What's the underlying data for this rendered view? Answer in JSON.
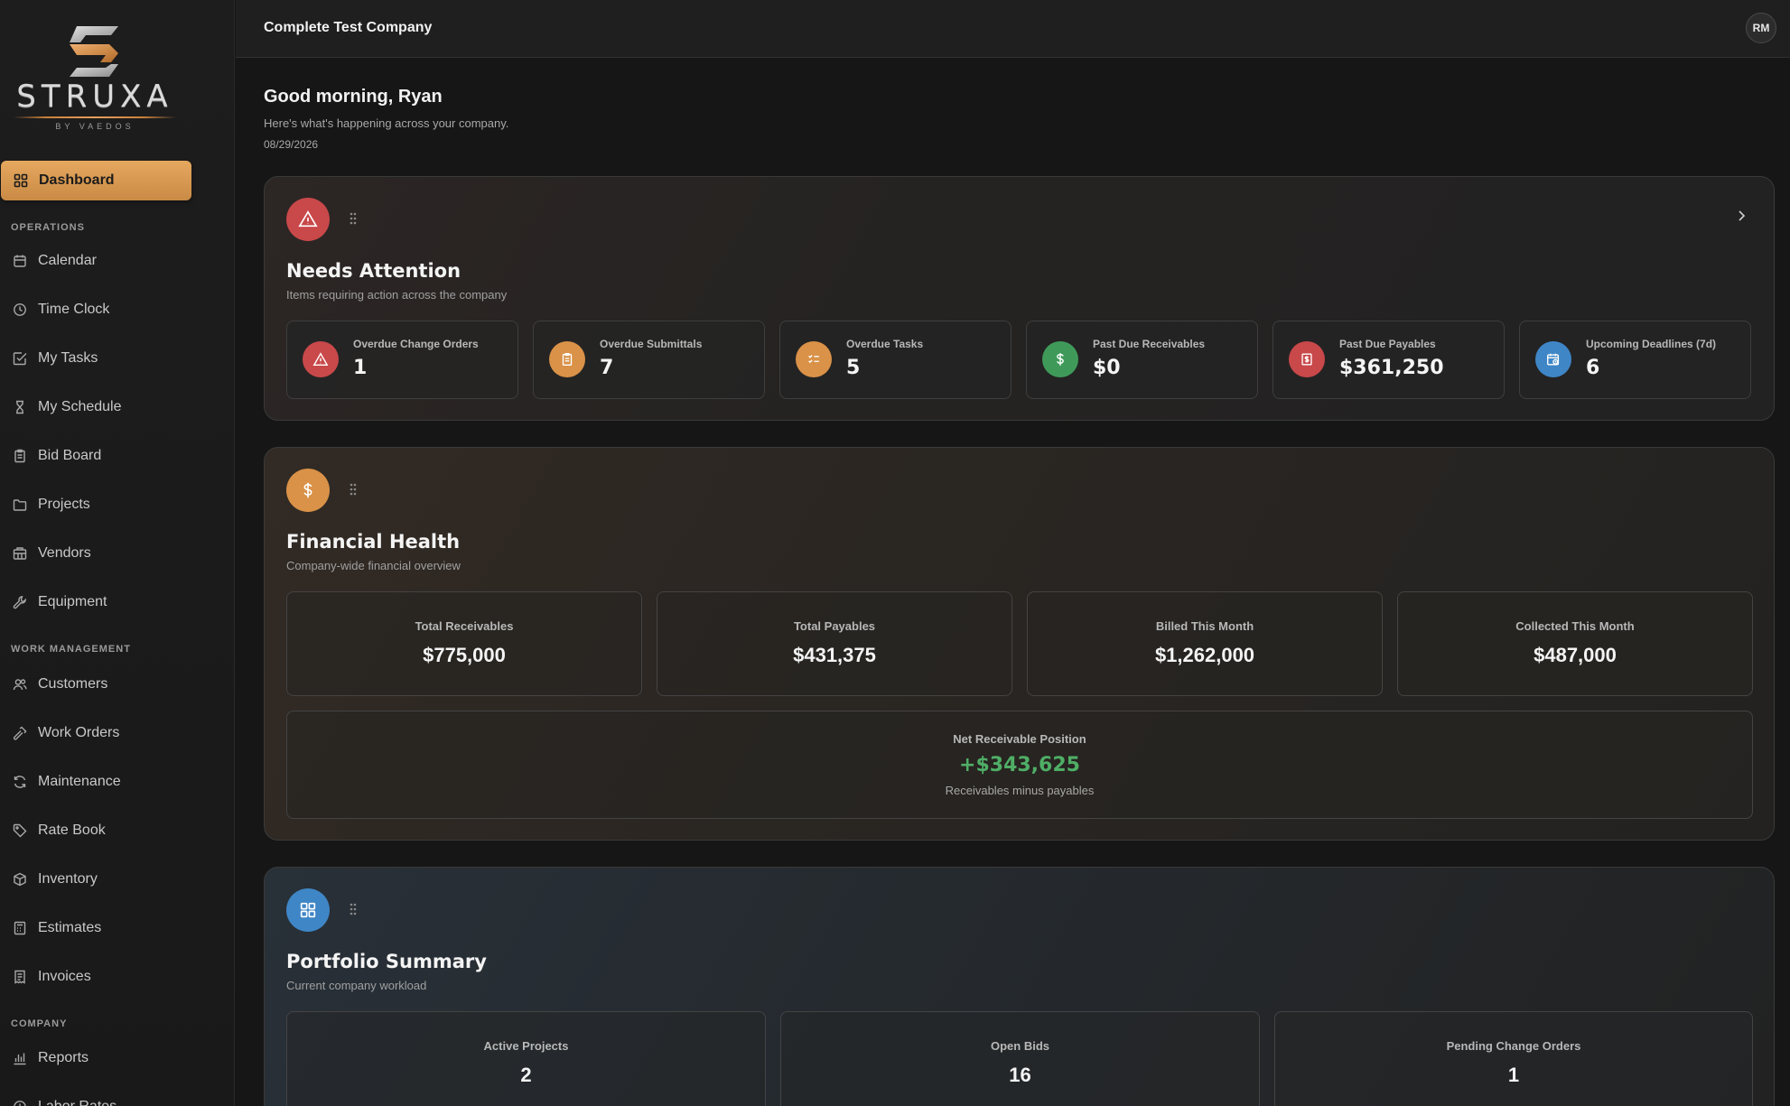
{
  "brand": {
    "name": "STRUXA",
    "tagline": "BY VAEDOS"
  },
  "sidebar": {
    "active": {
      "label": "Dashboard",
      "icon": "grid-icon"
    },
    "sections": [
      {
        "label": "OPERATIONS",
        "items": [
          {
            "label": "Calendar",
            "icon": "calendar-icon"
          },
          {
            "label": "Time Clock",
            "icon": "clock-icon"
          },
          {
            "label": "My Tasks",
            "icon": "check-square-icon"
          },
          {
            "label": "My Schedule",
            "icon": "hourglass-icon"
          },
          {
            "label": "Bid Board",
            "icon": "clipboard-icon"
          },
          {
            "label": "Projects",
            "icon": "folder-icon"
          },
          {
            "label": "Vendors",
            "icon": "building-icon"
          },
          {
            "label": "Equipment",
            "icon": "wrench-icon"
          }
        ]
      },
      {
        "label": "WORK MANAGEMENT",
        "items": [
          {
            "label": "Customers",
            "icon": "users-icon"
          },
          {
            "label": "Work Orders",
            "icon": "hammer-icon"
          },
          {
            "label": "Maintenance",
            "icon": "refresh-icon"
          },
          {
            "label": "Rate Book",
            "icon": "tag-icon"
          },
          {
            "label": "Inventory",
            "icon": "box-icon"
          },
          {
            "label": "Estimates",
            "icon": "calculator-icon"
          },
          {
            "label": "Invoices",
            "icon": "receipt-icon"
          }
        ]
      },
      {
        "label": "COMPANY",
        "items": [
          {
            "label": "Reports",
            "icon": "bar-chart-icon"
          },
          {
            "label": "Labor Rates",
            "icon": "clock-icon"
          }
        ]
      }
    ]
  },
  "topbar": {
    "company": "Complete Test Company",
    "avatar_initials": "RM"
  },
  "greeting": {
    "title": "Good morning, Ryan",
    "subtitle": "Here's what's happening across your company.",
    "date": "08/29/2026"
  },
  "needs_attention": {
    "title": "Needs Attention",
    "subtitle": "Items requiring action across the company",
    "items": [
      {
        "label": "Overdue Change Orders",
        "value": "1",
        "color": "#c9484a",
        "icon": "alert-triangle-icon"
      },
      {
        "label": "Overdue Submittals",
        "value": "7",
        "color": "#d99248",
        "icon": "clipboard-icon"
      },
      {
        "label": "Overdue Tasks",
        "value": "5",
        "color": "#d99248",
        "icon": "list-check-icon"
      },
      {
        "label": "Past Due Receivables",
        "value": "$0",
        "color": "#3f9a5a",
        "icon": "dollar-icon"
      },
      {
        "label": "Past Due Payables",
        "value": "$361,250",
        "color": "#c9484a",
        "icon": "bill-icon"
      },
      {
        "label": "Upcoming Deadlines (7d)",
        "value": "6",
        "color": "#3f86c6",
        "icon": "calendar-clock-icon"
      }
    ]
  },
  "financial_health": {
    "title": "Financial Health",
    "subtitle": "Company-wide financial overview",
    "stats": [
      {
        "label": "Total Receivables",
        "value": "$775,000"
      },
      {
        "label": "Total Payables",
        "value": "$431,375"
      },
      {
        "label": "Billed This Month",
        "value": "$1,262,000"
      },
      {
        "label": "Collected This Month",
        "value": "$487,000"
      }
    ],
    "net": {
      "label": "Net Receivable Position",
      "value": "+$343,625",
      "note": "Receivables minus payables",
      "color": "#4fae66"
    }
  },
  "portfolio_summary": {
    "title": "Portfolio Summary",
    "subtitle": "Current company workload",
    "stats": [
      {
        "label": "Active Projects",
        "value": "2"
      },
      {
        "label": "Open Bids",
        "value": "16"
      },
      {
        "label": "Pending Change Orders",
        "value": "1"
      }
    ]
  }
}
